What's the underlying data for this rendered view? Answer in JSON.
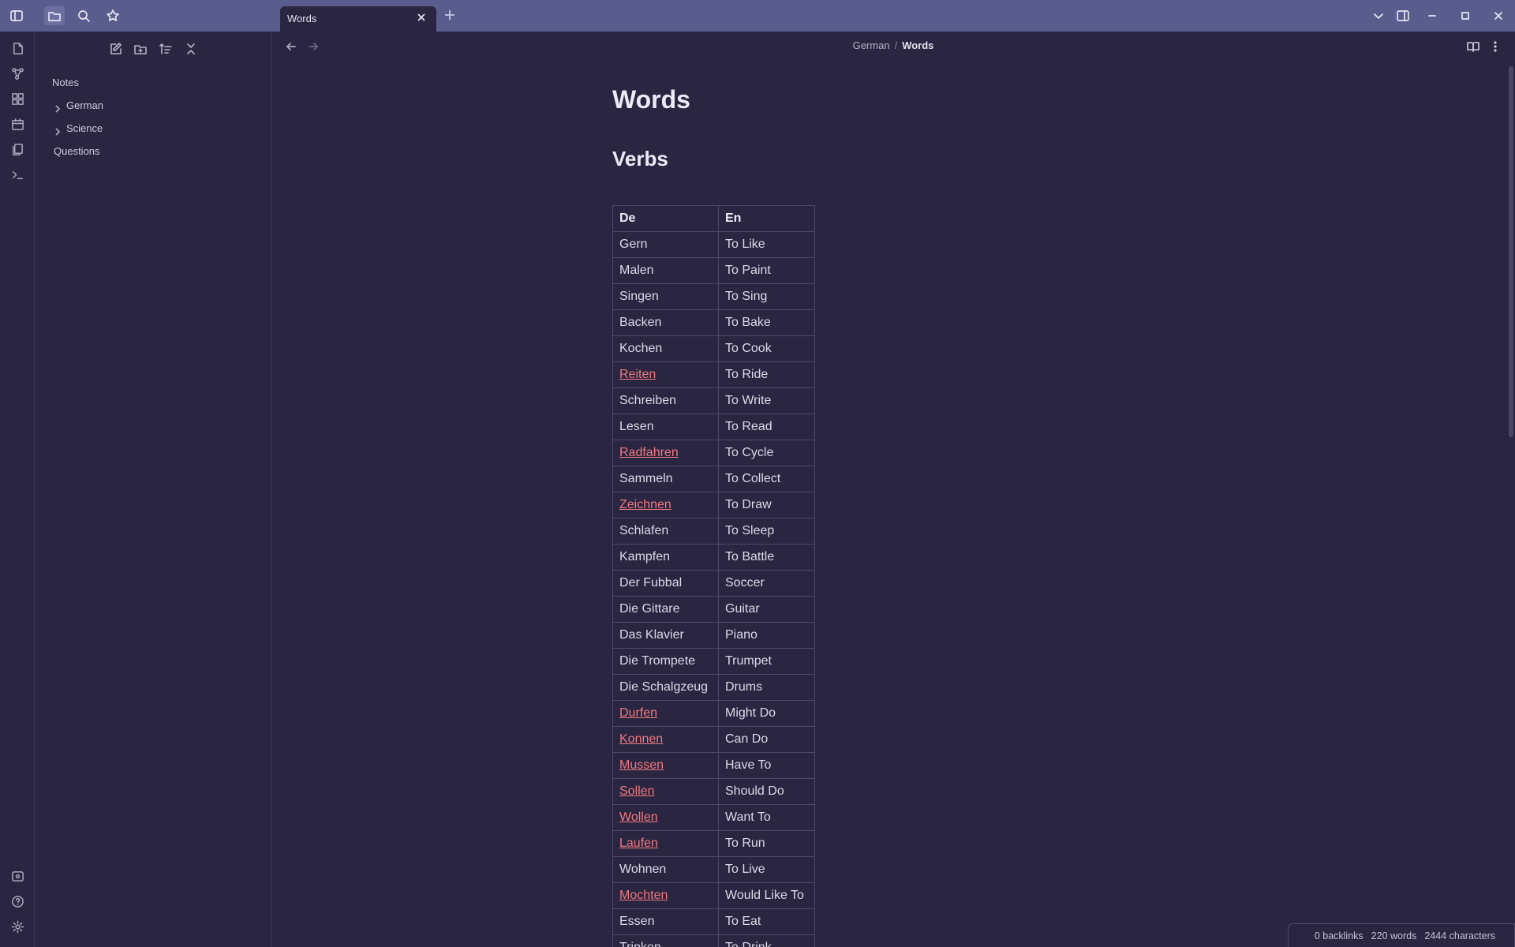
{
  "titlebar": {
    "tab_title": "Words"
  },
  "sidebar": {
    "items": [
      {
        "label": "Notes"
      },
      {
        "label": "German"
      },
      {
        "label": "Science"
      },
      {
        "label": "Questions"
      }
    ]
  },
  "breadcrumb": {
    "parent": "German",
    "separator": "/",
    "current": "Words"
  },
  "note": {
    "title": "Words",
    "heading": "Verbs",
    "table": {
      "headers": [
        "De",
        "En"
      ],
      "rows": [
        {
          "de": "Gern",
          "en": "To Like",
          "link": false
        },
        {
          "de": "Malen",
          "en": "To Paint",
          "link": false
        },
        {
          "de": "Singen",
          "en": "To Sing",
          "link": false
        },
        {
          "de": "Backen",
          "en": "To Bake",
          "link": false
        },
        {
          "de": "Kochen",
          "en": "To Cook",
          "link": false
        },
        {
          "de": "Reiten",
          "en": "To Ride",
          "link": true
        },
        {
          "de": "Schreiben",
          "en": "To Write",
          "link": false
        },
        {
          "de": "Lesen",
          "en": "To Read",
          "link": false
        },
        {
          "de": "Radfahren",
          "en": "To Cycle",
          "link": true
        },
        {
          "de": "Sammeln",
          "en": "To Collect",
          "link": false
        },
        {
          "de": "Zeichnen",
          "en": "To Draw",
          "link": true
        },
        {
          "de": "Schlafen",
          "en": "To Sleep",
          "link": false
        },
        {
          "de": "Kampfen",
          "en": "To Battle",
          "link": false
        },
        {
          "de": "Der Fubbal",
          "en": "Soccer",
          "link": false
        },
        {
          "de": "Die Gittare",
          "en": "Guitar",
          "link": false
        },
        {
          "de": "Das Klavier",
          "en": "Piano",
          "link": false
        },
        {
          "de": "Die Trompete",
          "en": "Trumpet",
          "link": false
        },
        {
          "de": "Die Schalgzeug",
          "en": "Drums",
          "link": false
        },
        {
          "de": "Durfen",
          "en": "Might Do",
          "link": true
        },
        {
          "de": "Konnen",
          "en": "Can Do",
          "link": true
        },
        {
          "de": "Mussen",
          "en": "Have To",
          "link": true
        },
        {
          "de": "Sollen",
          "en": "Should Do",
          "link": true
        },
        {
          "de": "Wollen",
          "en": "Want To",
          "link": true
        },
        {
          "de": "Laufen",
          "en": "To Run",
          "link": true
        },
        {
          "de": "Wohnen",
          "en": "To Live",
          "link": false
        },
        {
          "de": "Mochten",
          "en": "Would Like To",
          "link": true
        },
        {
          "de": "Essen",
          "en": "To Eat",
          "link": false
        },
        {
          "de": "Trinken",
          "en": "To Drink",
          "link": false
        }
      ]
    }
  },
  "status": {
    "backlinks": "0 backlinks",
    "words": "220 words",
    "characters": "2444 characters"
  },
  "colors": {
    "titlebar": "#595d8d",
    "background": "#2a2540",
    "link": "#f07a7e"
  }
}
